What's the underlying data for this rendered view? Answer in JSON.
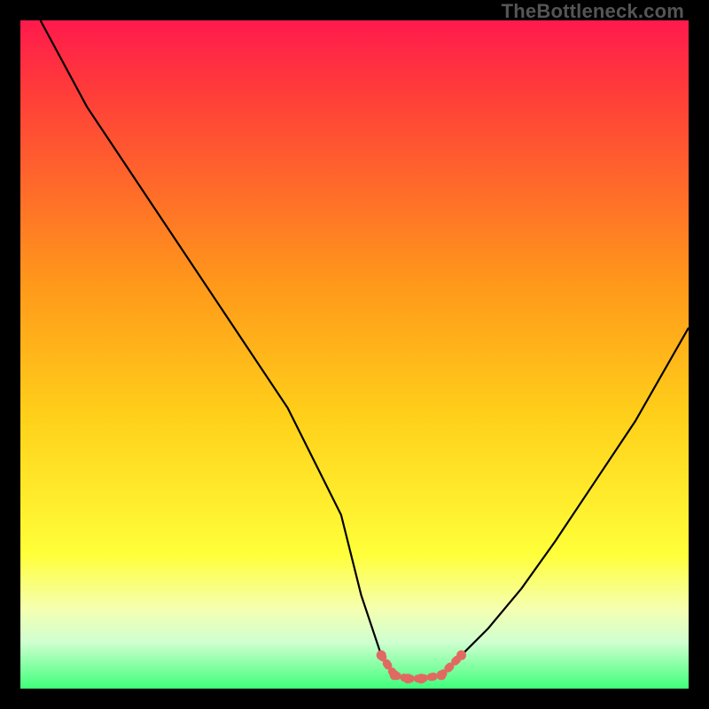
{
  "watermark": "TheBottleneck.com",
  "chart_data": {
    "type": "line",
    "title": "",
    "xlabel": "",
    "ylabel": "",
    "xlim": [
      0,
      100
    ],
    "ylim": [
      0,
      100
    ],
    "series": [
      {
        "name": "bottleneck-curve",
        "x": [
          3,
          10,
          20,
          30,
          40,
          48,
          51,
          54,
          56,
          58,
          60,
          63,
          66,
          70,
          75,
          80,
          86,
          92,
          100
        ],
        "values": [
          100,
          87,
          72,
          57,
          42,
          26,
          14,
          5,
          2,
          1.5,
          1.5,
          2,
          5,
          9,
          15,
          22,
          31,
          40,
          54
        ]
      }
    ],
    "highlight_segment": {
      "note": "flat region at trough drawn with thick salmon dots",
      "x": [
        54,
        56,
        58,
        60,
        63,
        66
      ],
      "values": [
        5,
        2,
        1.5,
        1.5,
        2,
        5
      ]
    }
  }
}
